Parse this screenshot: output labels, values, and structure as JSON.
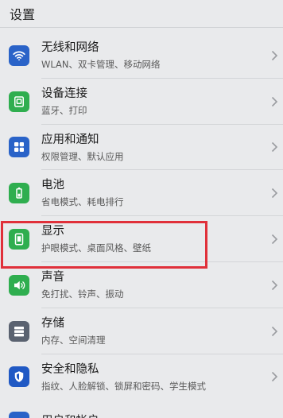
{
  "header": {
    "title": "设置"
  },
  "colors": {
    "highlight": "#e0303a",
    "wifi_icon_bg": "#2a63c8",
    "green_icon_bg": "#2fae4f",
    "grey_icon_bg": "#5a6270",
    "shield_icon_bg": "#2059c4"
  },
  "items": [
    {
      "icon": "wifi-icon",
      "title": "无线和网络",
      "subtitle": "WLAN、双卡管理、移动网络"
    },
    {
      "icon": "device-connect-icon",
      "title": "设备连接",
      "subtitle": "蓝牙、打印"
    },
    {
      "icon": "apps-icon",
      "title": "应用和通知",
      "subtitle": "权限管理、默认应用"
    },
    {
      "icon": "battery-icon",
      "title": "电池",
      "subtitle": "省电模式、耗电排行"
    },
    {
      "icon": "display-icon",
      "title": "显示",
      "subtitle": "护眼模式、桌面风格、壁纸"
    },
    {
      "icon": "sound-icon",
      "title": "声音",
      "subtitle": "免打扰、铃声、振动"
    },
    {
      "icon": "storage-icon",
      "title": "存储",
      "subtitle": "内存、空间清理"
    },
    {
      "icon": "shield-icon",
      "title": "安全和隐私",
      "subtitle": "指纹、人脸解锁、锁屏和密码、学生模式"
    }
  ],
  "partial_item": {
    "icon": "user-icon",
    "title": "用户和帐户"
  }
}
